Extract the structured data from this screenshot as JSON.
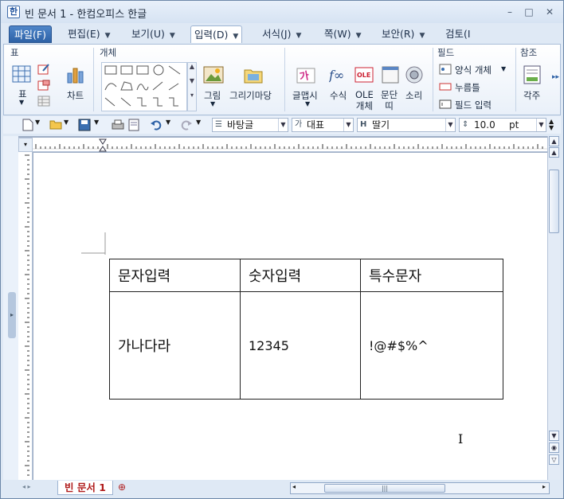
{
  "title": "빈 문서 1 - 한컴오피스 한글",
  "window_controls": {
    "minimize": "–",
    "maximize": "□",
    "close": "✕"
  },
  "menu": {
    "file": "파일(F)",
    "edit": "편집(E)",
    "view": "보기(U)",
    "input": "입력(D)",
    "format": "서식(J)",
    "page": "쪽(W)",
    "security": "보안(R)",
    "review": "검토(I"
  },
  "ribbon": {
    "groups": {
      "table": "표",
      "object": "개체",
      "field": "필드",
      "reference": "참조"
    },
    "table_label": "표",
    "chart_label": "차트",
    "picture_label": "그림",
    "drawing_label": "그리기마당",
    "textart_label": "글맵시",
    "formula_label": "수식",
    "ole_label": "OLE\n개체",
    "paragraph_label": "문단\n띠",
    "sound_label": "소리",
    "form_object_label": "양식 개체",
    "click_here_label": "누름틀",
    "field_input_label": "필드 입력",
    "footnote_label": "각주"
  },
  "toolbar": {
    "style": "바탕글",
    "lang_prefix": "가",
    "font_lang": "대표",
    "font_prefix": "H",
    "font": "딸기",
    "size": "10.0",
    "unit": "pt"
  },
  "document": {
    "table": {
      "headers": [
        "문자입력",
        "숫자입력",
        "특수문자"
      ],
      "rows": [
        [
          "가나다라",
          "12345",
          "!@#$%^"
        ]
      ]
    }
  },
  "status": {
    "doc_tab": "빈 문서 1"
  },
  "colors": {
    "accent": "#2d61a6",
    "doc_tab_text": "#b01c1c"
  }
}
